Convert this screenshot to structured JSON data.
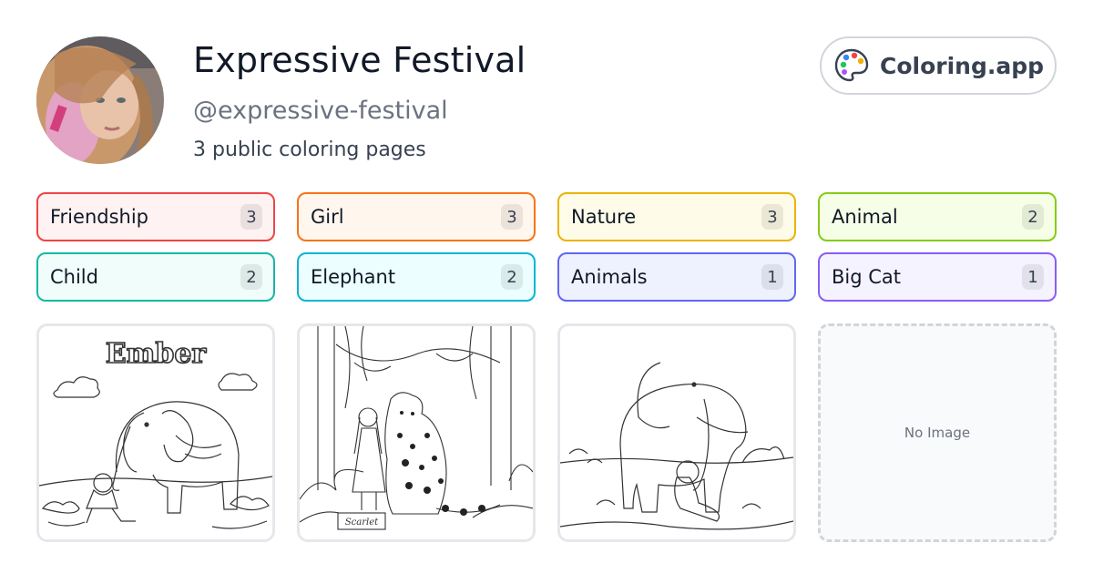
{
  "profile": {
    "name": "Expressive Festival",
    "handle": "@expressive-festival",
    "count_text": "3 public coloring pages"
  },
  "brand": {
    "label": "Coloring.app",
    "icon": "palette-icon"
  },
  "tags": [
    {
      "label": "Friendship",
      "count": "3",
      "border": "#ef4444",
      "bg": "#fef2f2"
    },
    {
      "label": "Girl",
      "count": "3",
      "border": "#f97316",
      "bg": "#fff7ed"
    },
    {
      "label": "Nature",
      "count": "3",
      "border": "#eab308",
      "bg": "#fefce8"
    },
    {
      "label": "Animal",
      "count": "2",
      "border": "#84cc16",
      "bg": "#f7fee7"
    },
    {
      "label": "Child",
      "count": "2",
      "border": "#14b8a6",
      "bg": "#f0fdfa"
    },
    {
      "label": "Elephant",
      "count": "2",
      "border": "#06b6d4",
      "bg": "#ecfeff"
    },
    {
      "label": "Animals",
      "count": "1",
      "border": "#6366f1",
      "bg": "#eef2ff"
    },
    {
      "label": "Big Cat",
      "count": "1",
      "border": "#8b5cf6",
      "bg": "#f5f3ff"
    }
  ],
  "cards": {
    "card1_title": "Ember",
    "card2_caption": "Scarlet",
    "no_image_label": "No Image"
  }
}
